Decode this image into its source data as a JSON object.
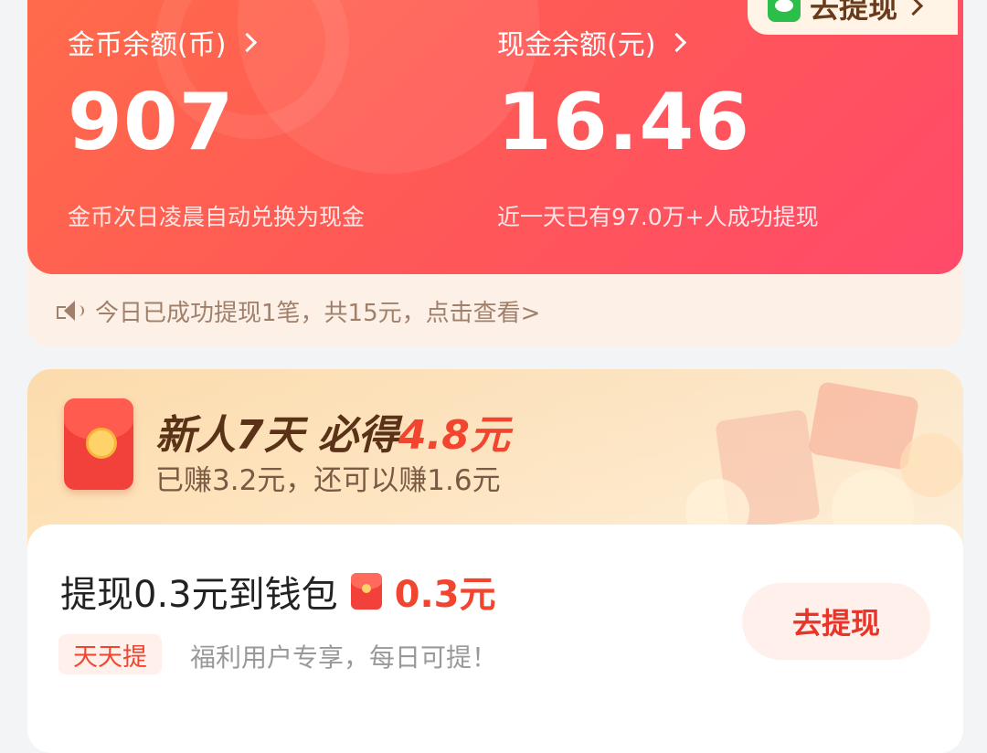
{
  "balance": {
    "coins": {
      "label": "金币余额(币)",
      "value": "907",
      "note": "金币次日凌晨自动兑换为现金"
    },
    "cash": {
      "label": "现金余额(元)",
      "value": "16.46",
      "note": "近一天已有97.0万+人成功提现"
    },
    "withdraw_label": "去提现"
  },
  "notice": {
    "text": "今日已成功提现1笔，共15元，点击查看>"
  },
  "promo": {
    "title_prefix": "新人7天 必得",
    "title_amount": "4.8元",
    "subtitle": "已赚3.2元，还可以赚1.6元"
  },
  "task": {
    "title": "提现0.3元到钱包",
    "reward": "0.3元",
    "tag": "天天提",
    "desc": "福利用户专享，每日可提！",
    "button": "去提现"
  },
  "colors": {
    "accent": "#ff5a55",
    "reward": "#f2452f",
    "wechat": "#2bbf4a"
  }
}
